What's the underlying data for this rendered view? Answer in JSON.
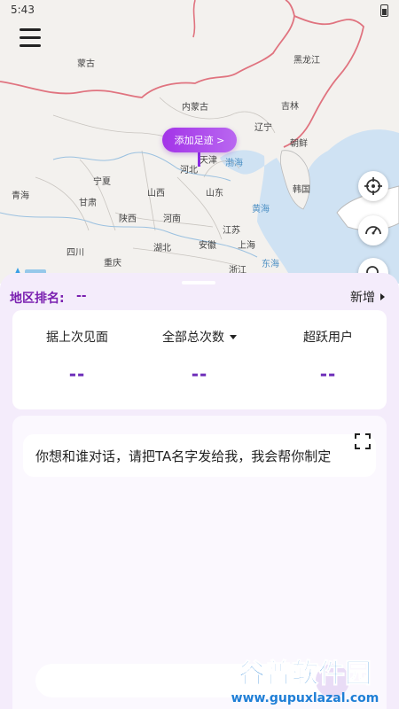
{
  "status_bar": {
    "time": "5:43"
  },
  "map": {
    "regions": [
      "蒙古",
      "黑龙江",
      "内蒙古",
      "吉林",
      "辽宁",
      "朝鲜",
      "天津",
      "河北",
      "宁夏",
      "青海",
      "甘肃",
      "山西",
      "山东",
      "韩国",
      "陕西",
      "河南",
      "江苏",
      "四川",
      "湖北",
      "安徽",
      "上海",
      "重庆",
      "浙江"
    ],
    "seas": [
      "渤海",
      "黄海",
      "东海"
    ],
    "footprint_button": "添加足迹 >"
  },
  "icons": {
    "menu": "menu-icon",
    "locate": "crosshair-icon",
    "speed": "speedometer-icon",
    "search": "search-icon",
    "expand": "fullscreen-icon"
  },
  "panel": {
    "rank_label": "地区排名:",
    "rank_value": "--",
    "new_label": "新增",
    "stats": [
      {
        "title": "据上次见面",
        "value": "--"
      },
      {
        "title": "全部总次数",
        "value": "--",
        "has_dropdown": true
      },
      {
        "title": "超跃用户",
        "value": "--"
      }
    ],
    "chat_message": "你想和谁对话，请把TA名字发给我，我会帮你制定"
  },
  "colors": {
    "accent": "#7a1fb0",
    "pill_start": "#a334e8",
    "sheet_bg": "#f4ecfb",
    "sea": "#cfe2f3"
  }
}
